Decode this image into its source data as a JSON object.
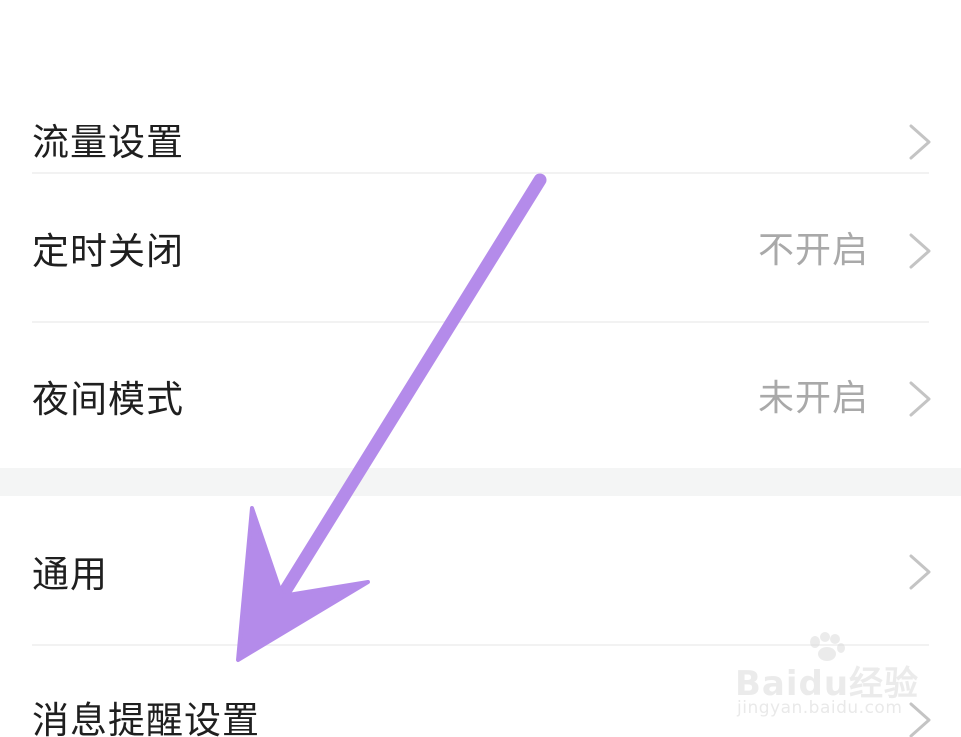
{
  "settings_list": {
    "items": [
      {
        "label": "流量设置",
        "value": ""
      },
      {
        "label": "定时关闭",
        "value": "不开启"
      },
      {
        "label": "夜间模式",
        "value": "未开启"
      },
      {
        "label": "通用",
        "value": ""
      },
      {
        "label": "消息提醒设置",
        "value": ""
      }
    ]
  },
  "annotation": {
    "arrow_color": "#b48bea"
  },
  "watermark": {
    "brand": "Baidu经验",
    "url": "jingyan.baidu.com"
  },
  "colors": {
    "label_text": "#1f1f1f",
    "value_text": "#a9a9a9",
    "chevron": "#c4c4c4",
    "section_gap": "#f4f5f5"
  }
}
